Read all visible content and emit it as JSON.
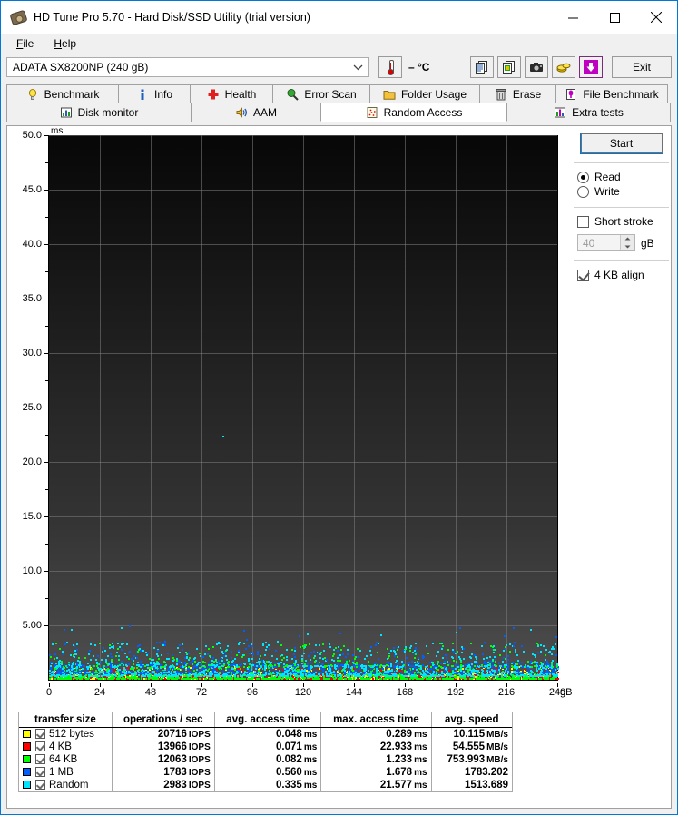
{
  "window": {
    "title": "HD Tune Pro 5.70 - Hard Disk/SSD Utility (trial version)",
    "icon": "harddisk-icon",
    "minimize": "–",
    "maximize": "□",
    "close": "✕"
  },
  "menu": {
    "items": [
      {
        "label": "File"
      },
      {
        "label": "Help"
      }
    ]
  },
  "toolbar": {
    "device": "ADATA SX8200NP (240 gB)",
    "temperature": "– °C",
    "buttons": [
      {
        "name": "copy-text-button",
        "icon": "copy-text-icon"
      },
      {
        "name": "copy-image-button",
        "icon": "copy-image-icon"
      },
      {
        "name": "screenshot-button",
        "icon": "camera-icon"
      },
      {
        "name": "donate-button",
        "icon": "coins-icon"
      },
      {
        "name": "download-button",
        "icon": "download-arrow-icon"
      }
    ],
    "exit_label": "Exit"
  },
  "tabs": {
    "row1": [
      {
        "label": "Benchmark",
        "icon": "lightbulb-icon",
        "active": false
      },
      {
        "label": "Info",
        "icon": "info-icon",
        "active": false
      },
      {
        "label": "Health",
        "icon": "red-cross-icon",
        "active": false
      },
      {
        "label": "Error Scan",
        "icon": "magnifier-icon",
        "active": false
      },
      {
        "label": "Folder Usage",
        "icon": "folder-icon",
        "active": false
      },
      {
        "label": "Erase",
        "icon": "trash-icon",
        "active": false
      },
      {
        "label": "File Benchmark",
        "icon": "file-benchmark-icon",
        "active": false
      }
    ],
    "row2": [
      {
        "label": "Disk monitor",
        "icon": "bar-chart-icon",
        "active": false
      },
      {
        "label": "AAM",
        "icon": "speaker-icon",
        "active": false
      },
      {
        "label": "Random Access",
        "icon": "scatter-icon",
        "active": true
      },
      {
        "label": "Extra tests",
        "icon": "chart-icon",
        "active": false
      }
    ]
  },
  "controls": {
    "start_label": "Start",
    "mode": [
      {
        "label": "Read",
        "selected": true
      },
      {
        "label": "Write",
        "selected": false
      }
    ],
    "short_stroke": {
      "label": "Short stroke",
      "checked": false
    },
    "short_stroke_value": "40",
    "short_stroke_unit": "gB",
    "align": {
      "label": "4 KB align",
      "checked": true
    }
  },
  "chart_data": {
    "type": "scatter",
    "title": "",
    "xlabel": "gB",
    "ylabel": "ms",
    "xlim": [
      0,
      240
    ],
    "ylim": [
      0,
      50
    ],
    "xticks": [
      0,
      24,
      48,
      72,
      96,
      120,
      144,
      168,
      192,
      216,
      240
    ],
    "xticklabels": [
      "0",
      "24",
      "48",
      "72",
      "96",
      "120",
      "144",
      "168",
      "192",
      "216",
      "240"
    ],
    "yticks": [
      5,
      10,
      15,
      20,
      25,
      30,
      35,
      40,
      45,
      50
    ],
    "yticklabels": [
      "5.00",
      "10.0",
      "15.0",
      "20.0",
      "25.0",
      "30.0",
      "35.0",
      "40.0",
      "45.0",
      "50.0"
    ],
    "yminorticks": [
      2.5,
      7.5,
      12.5,
      17.5,
      22.5,
      27.5,
      32.5,
      37.5,
      42.5,
      47.5
    ],
    "grid": true,
    "background": "dark-gradient",
    "series": [
      {
        "name": "512 bytes",
        "color": "#ffff00",
        "avg_ms": 0.048,
        "max_ms": 0.289
      },
      {
        "name": "4 KB",
        "color": "#ff0000",
        "avg_ms": 0.071,
        "max_ms": 22.933
      },
      {
        "name": "64 KB",
        "color": "#00ff00",
        "avg_ms": 0.082,
        "max_ms": 1.233
      },
      {
        "name": "1 MB",
        "color": "#0060ff",
        "avg_ms": 0.56,
        "max_ms": 1.678
      },
      {
        "name": "Random",
        "color": "#00e5ff",
        "avg_ms": 0.335,
        "max_ms": 21.577
      }
    ],
    "notes": "Dense point cloud concentrated below ~1.5 ms across the full 0-240 gB span; sparse cyan/blue outliers up to ~3 ms and one isolated cyan point near 82 gB / 22.3 ms."
  },
  "results": {
    "columns": [
      "transfer size",
      "operations / sec",
      "avg. access time",
      "max. access time",
      "avg. speed"
    ],
    "rows": [
      {
        "color": "#ffff00",
        "checked": true,
        "size": "512 bytes",
        "iops": "20716",
        "iops_unit": "IOPS",
        "avg": "0.048",
        "avg_unit": "ms",
        "max": "0.289",
        "max_unit": "ms",
        "speed": "10.115",
        "speed_unit": "MB/s"
      },
      {
        "color": "#ff0000",
        "checked": true,
        "size": "4 KB",
        "iops": "13966",
        "iops_unit": "IOPS",
        "avg": "0.071",
        "avg_unit": "ms",
        "max": "22.933",
        "max_unit": "ms",
        "speed": "54.555",
        "speed_unit": "MB/s"
      },
      {
        "color": "#00ff00",
        "checked": true,
        "size": "64 KB",
        "iops": "12063",
        "iops_unit": "IOPS",
        "avg": "0.082",
        "avg_unit": "ms",
        "max": "1.233",
        "max_unit": "ms",
        "speed": "753.993",
        "speed_unit": "MB/s"
      },
      {
        "color": "#0060ff",
        "checked": true,
        "size": "1 MB",
        "iops": "1783",
        "iops_unit": "IOPS",
        "avg": "0.560",
        "avg_unit": "ms",
        "max": "1.678",
        "max_unit": "ms",
        "speed": "1783.202",
        "speed_unit": ""
      },
      {
        "color": "#00e5ff",
        "checked": true,
        "size": "Random",
        "iops": "2983",
        "iops_unit": "IOPS",
        "avg": "0.335",
        "avg_unit": "ms",
        "max": "21.577",
        "max_unit": "ms",
        "speed": "1513.689",
        "speed_unit": ""
      }
    ]
  }
}
